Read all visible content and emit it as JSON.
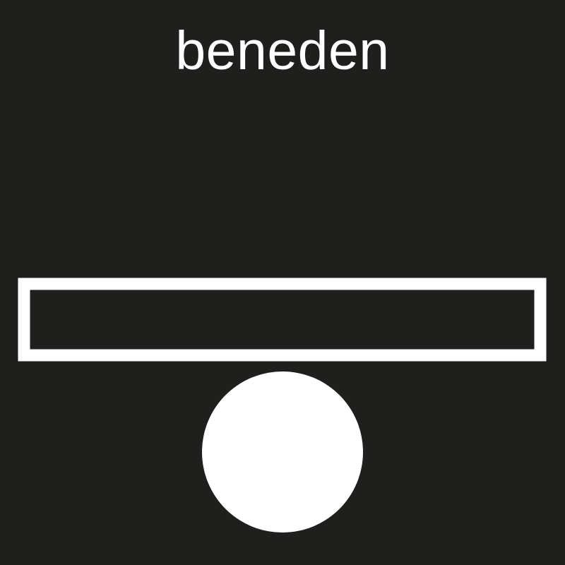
{
  "card": {
    "title": "beneden",
    "background_color": "#1f1f1e",
    "foreground_color": "#ffffff"
  },
  "pictogram": {
    "meaning": "below",
    "elements": [
      "reference-bar-outline",
      "circle-below-bar"
    ]
  }
}
